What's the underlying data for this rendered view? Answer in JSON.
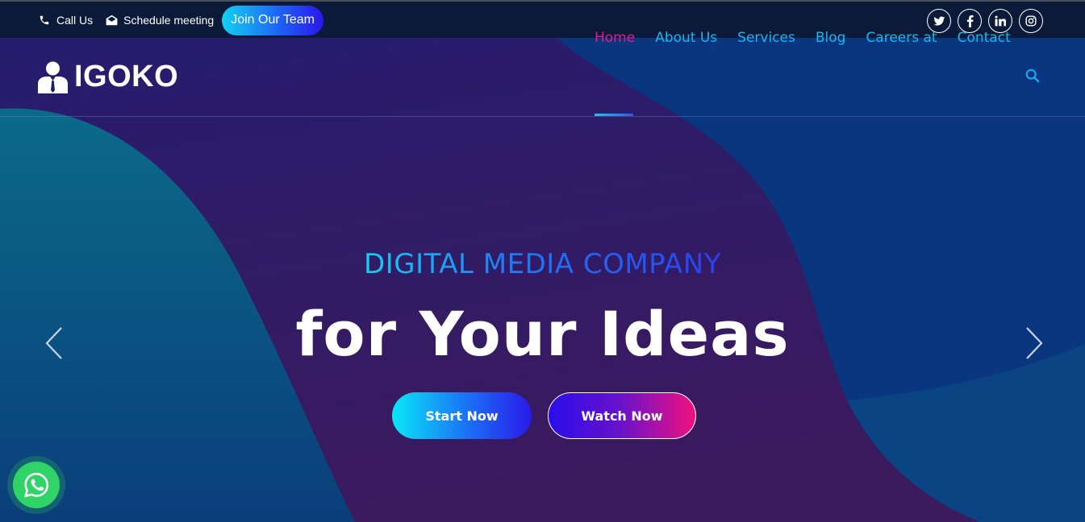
{
  "topbar": {
    "call_label": "Call Us",
    "meeting_label": "Schedule meeting",
    "join_label": "Join Our Team",
    "social": [
      {
        "icon": "twitter-icon",
        "glyph": "t"
      },
      {
        "icon": "facebook-icon",
        "glyph": "f"
      },
      {
        "icon": "linkedin-icon",
        "glyph": "in"
      },
      {
        "icon": "instagram-icon",
        "glyph": "◎"
      }
    ]
  },
  "brand": {
    "name": "IGOKO",
    "icon": "user-icon"
  },
  "nav": {
    "items": [
      "Home",
      "About Us",
      "Services",
      "Blog",
      "Careers at",
      "Contact"
    ],
    "active_index": 0,
    "search_icon": "search-icon"
  },
  "hero": {
    "subtitle": "DIGITAL MEDIA COMPANY",
    "title": "for Your Ideas",
    "start_button": "Start Now",
    "watch_button": "Watch Now",
    "prev_icon": "chevron-left-icon",
    "next_icon": "chevron-right-icon"
  },
  "floating": {
    "whatsapp_icon": "whatsapp-icon"
  },
  "colors": {
    "accent_cyan": "#13c8f2",
    "accent_pink": "#e5198f",
    "whatsapp_green": "#2fd366",
    "topbar_bg": "#0b1a38"
  }
}
